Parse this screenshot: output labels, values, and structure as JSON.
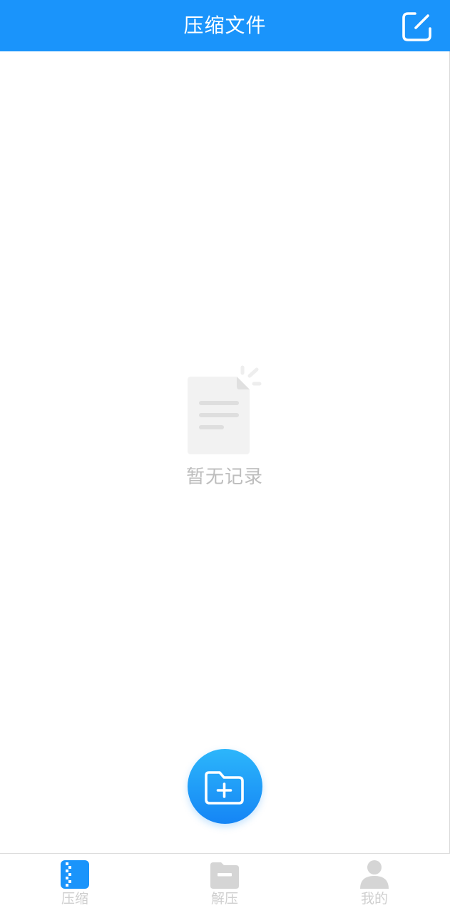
{
  "header": {
    "title": "压缩文件",
    "edit_icon": "edit-square-icon"
  },
  "empty": {
    "icon": "document-empty-icon",
    "text": "暂无记录"
  },
  "fab": {
    "icon": "folder-add-icon"
  },
  "tabs": [
    {
      "label": "压缩",
      "icon": "zip-file-icon",
      "active": true
    },
    {
      "label": "解压",
      "icon": "folder-minus-icon",
      "active": false
    },
    {
      "label": "我的",
      "icon": "user-icon",
      "active": false
    }
  ],
  "colors": {
    "primary": "#1a94fb",
    "inactive": "#cfcfcf",
    "empty_text": "#bdbdbd"
  }
}
